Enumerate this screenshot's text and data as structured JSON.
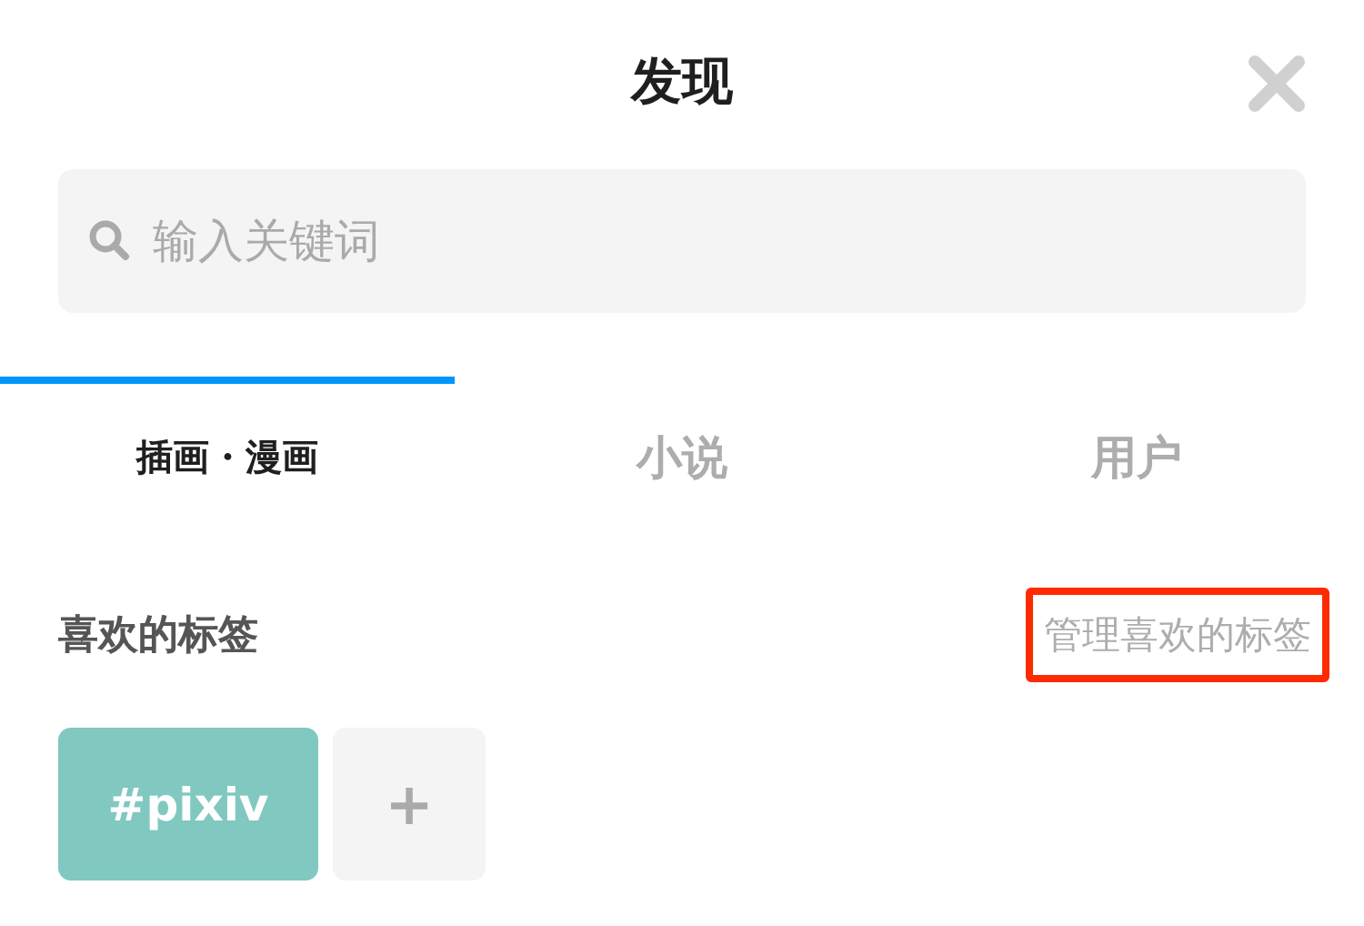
{
  "title": "发现",
  "search": {
    "placeholder": "输入关键词"
  },
  "tabs": [
    {
      "label": "插画・漫画",
      "selected": true
    },
    {
      "label": "小说",
      "selected": false
    },
    {
      "label": "用户",
      "selected": false
    }
  ],
  "favorite_tags": {
    "heading": "喜欢的标签",
    "manage_link": {
      "label": "管理喜欢的标签",
      "highlighted": true
    },
    "tags": [
      {
        "kind": "tag",
        "label": "#pixiv",
        "color": "#80c8c0"
      },
      {
        "kind": "add",
        "label": "+"
      }
    ]
  }
}
